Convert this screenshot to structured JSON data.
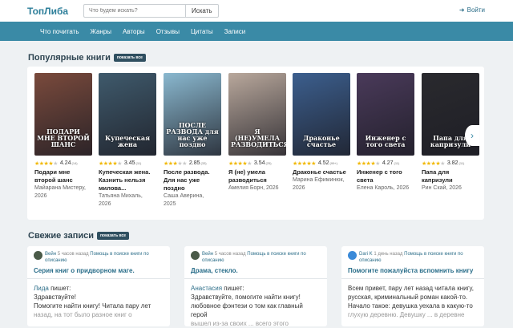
{
  "header": {
    "logo": "ТопЛиба",
    "search_placeholder": "Что будем искать?",
    "search_button": "Искать",
    "login_label": "Войти"
  },
  "nav": [
    "Что почитать",
    "Жанры",
    "Авторы",
    "Отзывы",
    "Цитаты",
    "Записи"
  ],
  "popular": {
    "title": "Популярные книги",
    "show_all": "показать все",
    "books": [
      {
        "cover_text": "ПОДАРИ МНЕ ВТОРОЙ ШАНС",
        "rating": "4.24",
        "count": "(14)",
        "stars": 4,
        "title": "Подари мне второй шанс",
        "author": "Майарана Мистеру,",
        "year": "2026",
        "color": "#7a4a3c"
      },
      {
        "cover_text": "Купеческая жена",
        "rating": "3.45",
        "count": "(11)",
        "stars": 4,
        "title": "Купеческая жена. Казнить нельзя милова...",
        "author": "Татьяна Михаль,",
        "year": "2026",
        "color": "#3f5a6c"
      },
      {
        "cover_text": "ПОСЛЕ РАЗВОДА для нас уже поздно",
        "rating": "2.85",
        "count": "(33)",
        "stars": 3,
        "title": "После развода. Для нас уже поздно",
        "author": "Саша Аверина,",
        "year": "2025",
        "color": "#8ab8cf"
      },
      {
        "cover_text": "Я (НЕ)УМЕЛА РАЗВОДИТЬСЯ",
        "rating": "3.54",
        "count": "(25)",
        "stars": 4,
        "title": "Я (не) умела разводиться",
        "author": "Амелия Борн, 2026",
        "year": "",
        "color": "#b9a89c"
      },
      {
        "cover_text": "Драконье счастье",
        "rating": "4.52",
        "count": "(99+)",
        "stars": 5,
        "title": "Драконье счастье",
        "author": "Марина Ефиминюк,",
        "year": "2026",
        "color": "#3c5f8e"
      },
      {
        "cover_text": "Инженер с того света",
        "rating": "4.27",
        "count": "(11)",
        "stars": 4,
        "title": "Инженер с того света",
        "author": "Елена Кароль, 2026",
        "year": "",
        "color": "#4a3a5a"
      },
      {
        "cover_text": "Папа для капризули",
        "rating": "3.82",
        "count": "(11)",
        "stars": 4,
        "title": "Папа для капризули",
        "author": "Рин Скай, 2026",
        "year": "",
        "color": "#2a2a2e"
      }
    ]
  },
  "records": {
    "title": "Свежие записи",
    "show_all": "показать все",
    "posts": [
      {
        "user": "Вейн",
        "time": "5 часов назад",
        "category": "Помощь в поиске книги по описанию",
        "title": "Серия книг о придворном маге.",
        "author": "Лида",
        "verb": "пишет:",
        "lines": [
          "Здравствуйте!",
          "Помогите найти книгу! Читала пару лет",
          "назад, на тот было разное книг о"
        ],
        "avatar_color": "#4a5a48"
      },
      {
        "user": "Вейн",
        "time": "5 часов назад",
        "category": "Помощь в поиске книги по описанию",
        "title": "Драма, стекло.",
        "author": "Анастасия",
        "verb": "пишет:",
        "lines": [
          "Здравствуйте,  помогите найти книгу!",
          "любовное фэнтези о том как главный герой",
          "вышел из-за своих ... всего этого"
        ],
        "avatar_color": "#4a5a48"
      },
      {
        "user": "Dari K",
        "time": "1 день назад",
        "category": "Помощь в поиске книги по описанию",
        "title": "Помогите пожалуйста вспомнить книгу",
        "author": "",
        "verb": "",
        "lines": [
          "Всем привет, пару лет назад читала книгу,",
          "русская, криминальный роман какой-то.",
          "Начало такое: девушка уехала в какую-то",
          "глухую деревню.  Девушку ... в деревне"
        ],
        "avatar_color": "#3a8ad8"
      }
    ]
  }
}
